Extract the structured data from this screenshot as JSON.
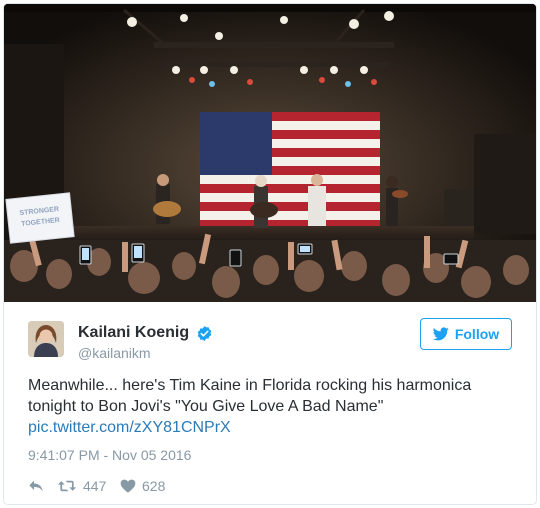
{
  "photo": {
    "sign_lines": [
      "STRONGER",
      "TOGETHER"
    ]
  },
  "author": {
    "name": "Kailani Koenig",
    "handle": "@kailanikm",
    "verified": true
  },
  "follow_button": {
    "label": "Follow",
    "icon": "twitter-bird-icon"
  },
  "tweet": {
    "text_lines": [
      "Meanwhile... here's Tim Kaine in Florida rocking his harmonica",
      "tonight to Bon Jovi's \"You Give Love A Bad Name\""
    ],
    "link": "pic.twitter.com/zXY81CNPrX",
    "timestamp": "9:41:07 PM - Nov 05 2016"
  },
  "actions": {
    "reply": {
      "icon": "reply-icon"
    },
    "retweet": {
      "icon": "retweet-icon",
      "count": "447"
    },
    "like": {
      "icon": "heart-icon",
      "count": "628"
    }
  },
  "colors": {
    "twitter_blue": "#1da1f2",
    "link_blue": "#2b7bb9",
    "secondary_text": "#8899a6",
    "primary_text": "#292f33"
  }
}
